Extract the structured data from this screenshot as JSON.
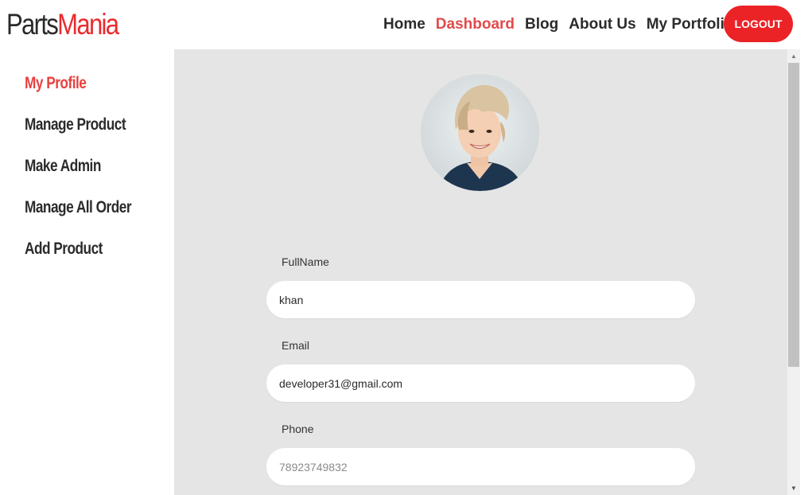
{
  "brand": {
    "part_a": "Parts",
    "part_b": "Mania",
    "color_a": "#2a2a2a",
    "color_b": "#ea2b2e"
  },
  "nav": {
    "items": [
      {
        "label": "Home",
        "active": false
      },
      {
        "label": "Dashboard",
        "active": true
      },
      {
        "label": "Blog",
        "active": false
      },
      {
        "label": "About Us",
        "active": false
      },
      {
        "label": "My Portfolio",
        "active": false
      }
    ],
    "logout_label": "LOGOUT",
    "accent": "#eb2327"
  },
  "sidebar": {
    "items": [
      {
        "label": "My Profile",
        "active": true
      },
      {
        "label": "Manage Product",
        "active": false
      },
      {
        "label": "Make Admin",
        "active": false
      },
      {
        "label": "Manage All Order",
        "active": false
      },
      {
        "label": "Add Product",
        "active": false
      }
    ]
  },
  "profile": {
    "avatar_icon": "profile-photo",
    "fields": {
      "fullname": {
        "label": "FullName",
        "value": "khan",
        "placeholder": ""
      },
      "email": {
        "label": "Email",
        "value": "developer31@gmail.com",
        "placeholder": ""
      },
      "phone": {
        "label": "Phone",
        "value": "",
        "placeholder": "78923749832"
      }
    }
  },
  "scrollbar": {
    "up_icon": "arrow-up-icon",
    "down_icon": "arrow-down-icon"
  }
}
